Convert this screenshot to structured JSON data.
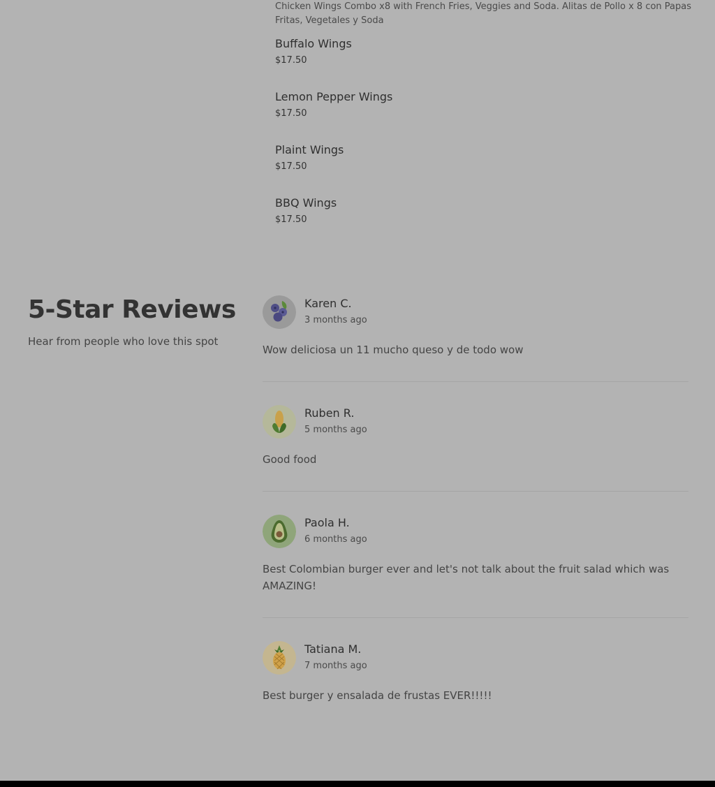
{
  "menu": {
    "combo_description": "Chicken Wings Combo x8 with French Fries, Veggies and Soda. Alitas de Pollo x 8 con Papas Fritas, Vegetales y Soda",
    "items": [
      {
        "name": "Buffalo Wings",
        "price": "$17.50"
      },
      {
        "name": "Lemon Pepper Wings",
        "price": "$17.50"
      },
      {
        "name": "Plaint Wings",
        "price": "$17.50"
      },
      {
        "name": "BBQ Wings",
        "price": "$17.50"
      }
    ]
  },
  "reviews": {
    "heading": "5-Star Reviews",
    "subheading": "Hear from people who love this spot",
    "items": [
      {
        "name": "Karen C.",
        "time": "3 months ago",
        "text": "Wow deliciosa un 11 mucho queso y de todo wow",
        "avatar_icon": "blueberries-icon"
      },
      {
        "name": "Ruben R.",
        "time": "5 months ago",
        "text": "Good food",
        "avatar_icon": "corn-icon"
      },
      {
        "name": "Paola H.",
        "time": "6 months ago",
        "text": "Best Colombian burger ever and let's not talk about the fruit salad which was AMAZING!",
        "avatar_icon": "avocado-icon"
      },
      {
        "name": "Tatiana M.",
        "time": "7 months ago",
        "text": "Best burger y ensalada de frustas EVER!!!!!",
        "avatar_icon": "pineapple-icon"
      }
    ]
  },
  "colors": {
    "overlay_background": "#b3b3b3",
    "footer_bar": "#000000"
  }
}
